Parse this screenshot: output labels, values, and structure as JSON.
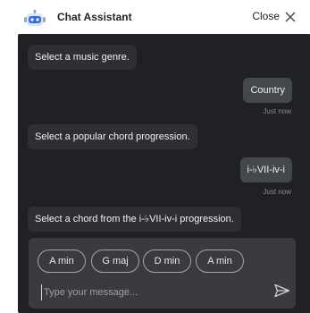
{
  "header": {
    "title": "Chat Assistant",
    "close_label": "Close",
    "bot_icon": "robot-icon",
    "close_icon": "close-icon"
  },
  "messages": [
    {
      "from": "bot",
      "text": "Select a music genre."
    },
    {
      "from": "user",
      "text": "Country",
      "time": "Just now"
    },
    {
      "from": "bot",
      "text": "Select a popular chord progression."
    },
    {
      "from": "user",
      "text": "i-♭VII-iv-i",
      "time": "Just now"
    },
    {
      "from": "bot",
      "text": "Select a chord from the i-♭VII-iv-i progression."
    }
  ],
  "composer": {
    "chips": [
      "A min",
      "G maj",
      "D min",
      "A min"
    ],
    "placeholder": "Type your message...",
    "send_icon": "send-icon"
  },
  "colors": {
    "chat_bg": "#1f2124",
    "bot_bubble": "#2d2f33",
    "user_bubble": "#44474c",
    "composer_bg": "#393b40",
    "bot_icon_accent": "#2f6fdc"
  }
}
